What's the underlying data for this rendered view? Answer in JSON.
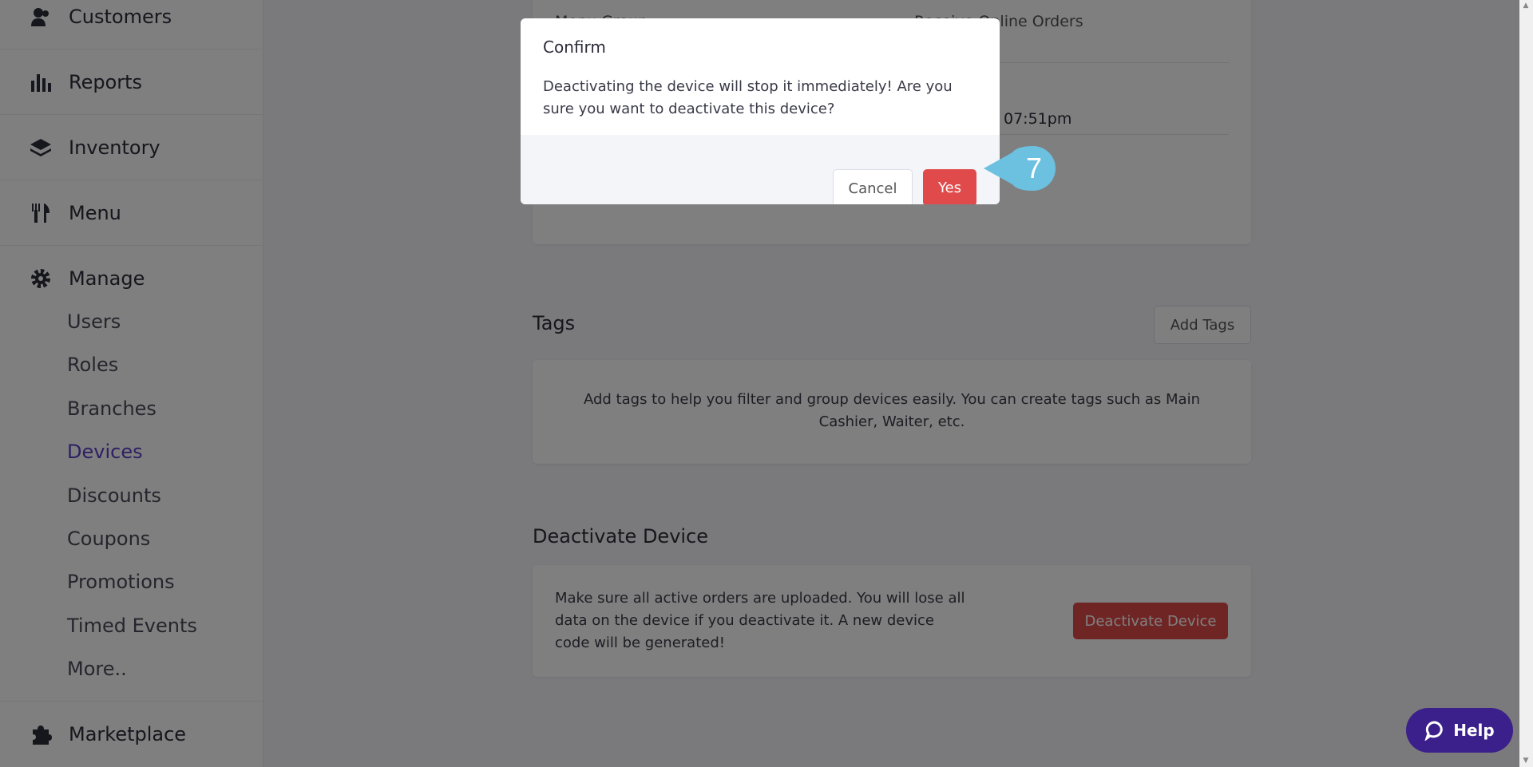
{
  "sidebar": {
    "items": [
      {
        "label": "Customers",
        "icon": "customers-icon"
      },
      {
        "label": "Reports",
        "icon": "reports-icon"
      },
      {
        "label": "Inventory",
        "icon": "inventory-icon"
      },
      {
        "label": "Menu",
        "icon": "menu-icon"
      },
      {
        "label": "Manage",
        "icon": "gear-icon"
      },
      {
        "label": "Marketplace",
        "icon": "puzzle-icon"
      }
    ],
    "manage_sub": [
      "Users",
      "Roles",
      "Branches",
      "Devices",
      "Discounts",
      "Coupons",
      "Promotions",
      "Timed Events",
      "More.."
    ]
  },
  "main": {
    "info_row1_label": "Menu Group",
    "info_row1_value": "Receive Online Orders",
    "info_row2_value": "07:51pm",
    "tags": {
      "title": "Tags",
      "add_button": "Add Tags",
      "empty_text": "Add tags to help you filter and group devices easily. You can create tags such as Main Cashier, Waiter, etc."
    },
    "deactivate": {
      "title": "Deactivate Device",
      "text": "Make sure all active orders are uploaded. You will lose all data on the device if you deactivate it. A new device code will be generated!",
      "button": "Deactivate Device"
    }
  },
  "modal": {
    "title": "Confirm",
    "body": "Deactivating the device will stop it immediately! Are you sure you want to deactivate this device?",
    "cancel": "Cancel",
    "yes": "Yes"
  },
  "callout": {
    "step": "7"
  },
  "help": {
    "label": "Help"
  },
  "colors": {
    "accent": "#5b3fc4",
    "danger": "#e14a4a",
    "callout": "#6cc0e0",
    "help": "#3b1f8a"
  }
}
